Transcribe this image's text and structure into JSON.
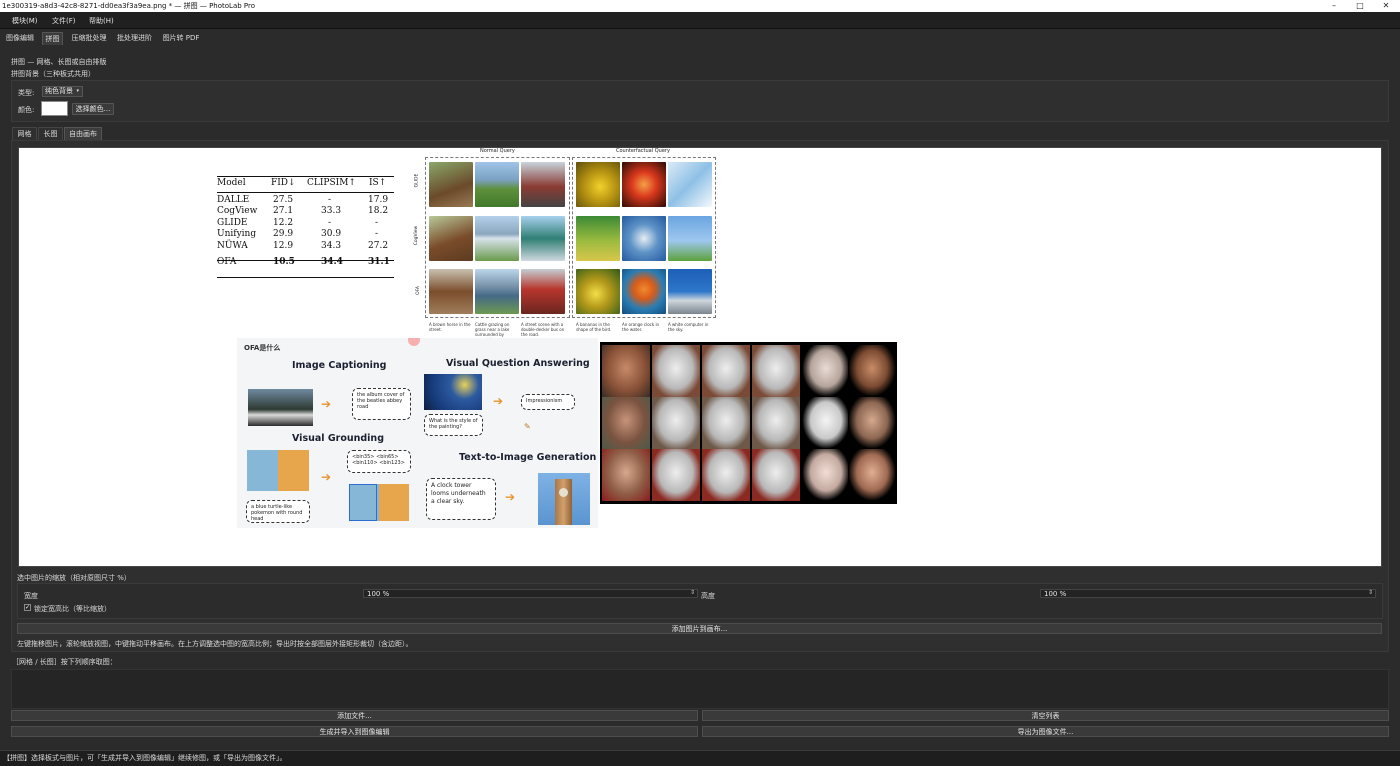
{
  "window": {
    "title": "1e300319-a8d3-42c8-8271-dd0ea3f3a9ea.png * — 拼图 — PhotoLab Pro",
    "minimize": "–",
    "maximize": "□",
    "close": "✕"
  },
  "menubar": {
    "items": [
      "模块(M)",
      "文件(F)",
      "帮助(H)"
    ]
  },
  "top_tabs": [
    "图像编辑",
    "拼图",
    "压缩批处理",
    "批处理进阶",
    "图片转 PDF"
  ],
  "active_top_tab": "拼图",
  "section": {
    "title": "拼图 — 网格、长图或自由排版",
    "bg_group": "拼图背景（三种板式共用）",
    "type_label": "类型:",
    "type_value": "纯色背景",
    "color_label": "颜色:",
    "color_button": "选择颜色...",
    "swatch_color": "#ffffff"
  },
  "mode_tabs": [
    "网格",
    "长图",
    "自由画布"
  ],
  "active_mode_tab": "自由画布",
  "canvas": {
    "table": {
      "headers": [
        "Model",
        "FID↓",
        "CLIPSIM↑",
        "IS↑"
      ],
      "rows": [
        [
          "DALLE",
          "27.5",
          "-",
          "17.9"
        ],
        [
          "CogView",
          "27.1",
          "33.3",
          "18.2"
        ],
        [
          "GLIDE",
          "12.2",
          "-",
          "-"
        ],
        [
          "Unifying",
          "29.9",
          "30.9",
          "-"
        ],
        [
          "NÜWA",
          "12.9",
          "34.3",
          "27.2"
        ]
      ],
      "best_row": [
        "OFA",
        "10.5",
        "34.4",
        "31.1"
      ]
    },
    "grid_figure": {
      "normal_query": "Normal Query",
      "counterfactual_query": "Counterfactual Query",
      "row_labels": [
        "GLIDE",
        "CogView",
        "OFA"
      ],
      "captions": [
        "A brown horse in the street.",
        "Cattle grazing on grass near a lake surrounded by mountain.",
        "A street scene with a double-decker bus on the road.",
        "A bananas in the shape of the bird.",
        "An orange clock in the water.",
        "A white computer in the sky."
      ]
    },
    "ofa_figure": {
      "header": "OFA是什么",
      "image_captioning": "Image Captioning",
      "vqa": "Visual Question Answering",
      "visual_grounding": "Visual Grounding",
      "t2i": "Text-to-Image Generation",
      "caption_bubble": "the album cover of the beatles abbey road",
      "vqa_answer": "Impressionism",
      "vqa_question": "What is the style of the painting?",
      "grounding_bins": "<bin35> <bin65> <bin110> <bin123>",
      "grounding_query": "a blue turtle-like pokemon with round head",
      "t2i_prompt": "A clock tower looms underneath a clear sky."
    }
  },
  "scale_group": {
    "title": "选中图片的缩放（相对原图尺寸 %）",
    "width_label": "宽度",
    "width_value": "100 %",
    "height_label": "高度",
    "height_value": "100 %",
    "lock_label": "锁定宽高比（等比缩放）",
    "lock_checked": "✓",
    "add_button": "添加图片到画布..."
  },
  "hint": "左键拖移图片，滚轮缩放视图，中键拖动平移画布。在上方调整选中图的宽高比例；导出时按全部图层外接矩形裁切（含边距）。",
  "list_title": "［网格 / 长图］按下列顺序取图：",
  "buttons": {
    "add_files": "添加文件...",
    "clear_list": "清空列表",
    "generate_import": "生成并导入到图像编辑",
    "export_image": "导出为图像文件..."
  },
  "status": "【拼图】选择板式与图片，可「生成并导入到图像编辑」继续修图，或「导出为图像文件」。"
}
